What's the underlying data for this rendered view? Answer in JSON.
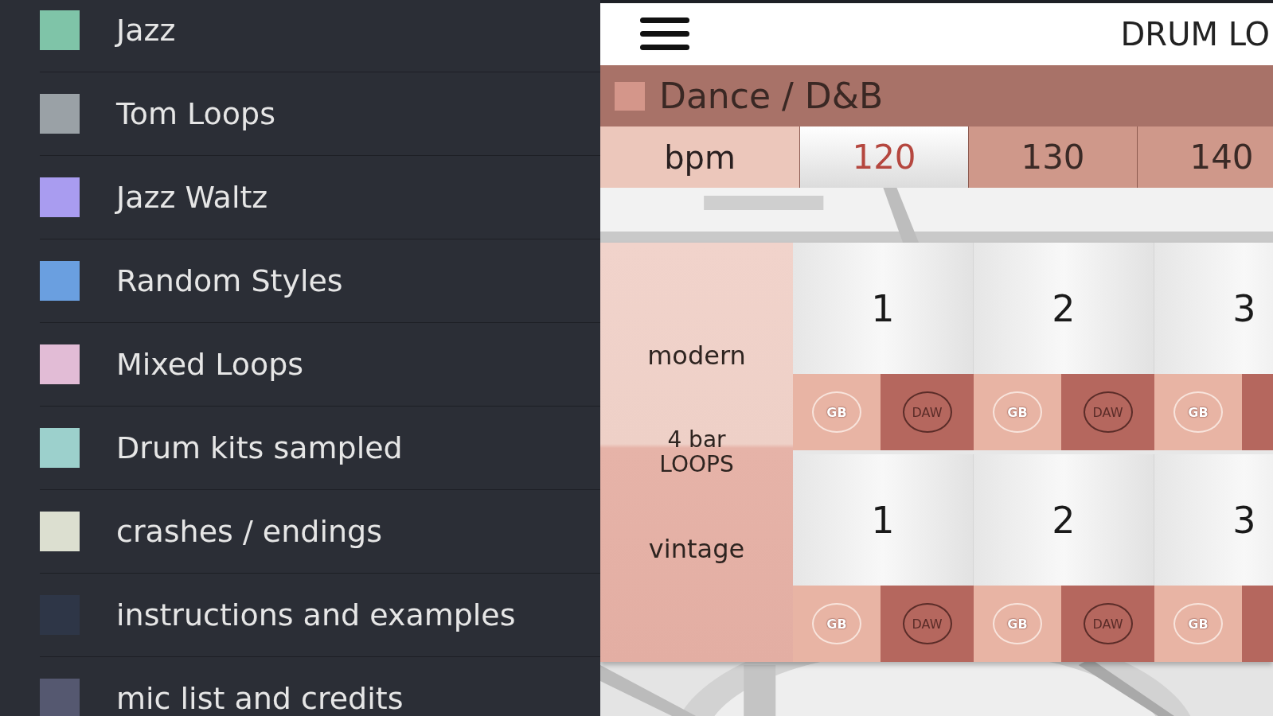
{
  "sidebar": {
    "items": [
      {
        "label": "Jazz",
        "color": "#7fc4a8"
      },
      {
        "label": "Tom Loops",
        "color": "#9aa1a6"
      },
      {
        "label": "Jazz Waltz",
        "color": "#a99cf0"
      },
      {
        "label": "Random Styles",
        "color": "#6a9fe0"
      },
      {
        "label": "Mixed Loops",
        "color": "#e2bcd6"
      },
      {
        "label": "Drum kits sampled",
        "color": "#9cd0cc"
      },
      {
        "label": "crashes / endings",
        "color": "#dcdfd0"
      },
      {
        "label": "instructions and examples",
        "color": "#2e3647"
      },
      {
        "label": "mic list and credits",
        "color": "#555870"
      }
    ]
  },
  "header": {
    "title": "DRUM LO"
  },
  "category": {
    "label": "Dance / D&B",
    "color": "#d4968a"
  },
  "bpm": {
    "label": "bpm",
    "options": [
      {
        "label": "120",
        "selected": true
      },
      {
        "label": "130",
        "selected": false
      },
      {
        "label": "140",
        "selected": false
      }
    ]
  },
  "loops_label": "4 bar LOOPS",
  "rows": [
    {
      "label": "modern",
      "cells": [
        {
          "number": "1",
          "gb": "GB",
          "daw": "DAW"
        },
        {
          "number": "2",
          "gb": "GB",
          "daw": "DAW"
        },
        {
          "number": "3",
          "gb": "GB"
        }
      ]
    },
    {
      "label": "vintage",
      "cells": [
        {
          "number": "1",
          "gb": "GB",
          "daw": "DAW"
        },
        {
          "number": "2",
          "gb": "GB",
          "daw": "DAW"
        },
        {
          "number": "3",
          "gb": "GB"
        }
      ]
    }
  ]
}
